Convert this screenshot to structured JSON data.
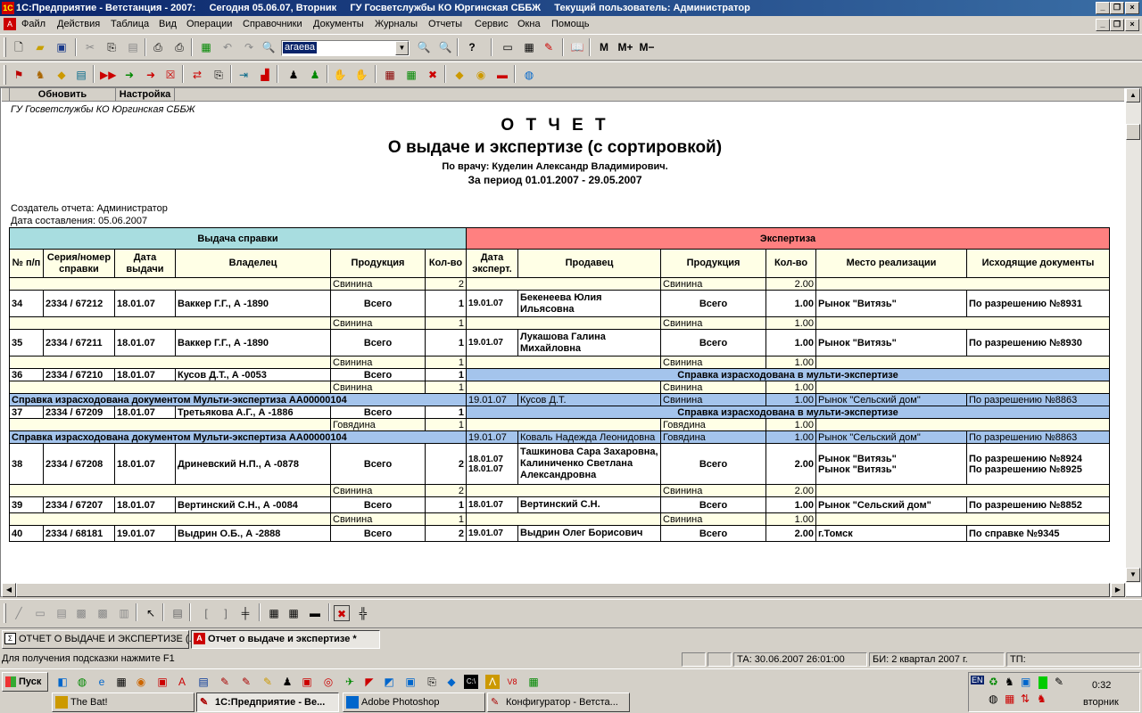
{
  "window": {
    "title": "1С:Предприятие - Ветстанция - 2007:",
    "today": "Сегодня 05.06.07, Вторник",
    "org": "ГУ Госветслужбы КО Юргинская СББЖ",
    "user": "Текущий пользователь: Администратор"
  },
  "menu": [
    "Файл",
    "Действия",
    "Таблица",
    "Вид",
    "Операции",
    "Справочники",
    "Документы",
    "Журналы",
    "Отчеты",
    "Сервис",
    "Окна",
    "Помощь"
  ],
  "toolbar": {
    "search_value": "агаева",
    "m": "M",
    "mplus": "M+",
    "mminus": "M−"
  },
  "docbar": {
    "refresh": "Обновить",
    "settings": "Настройка"
  },
  "report": {
    "org": "ГУ Госветслужбы КО Юргинская СББЖ",
    "title": "О Т Ч Е Т",
    "subtitle": "О выдаче и экспертизе (с сортировкой)",
    "doctor": "По врачу: Куделин Александр Владимирович.",
    "period": "За период 01.01.2007  - 29.05.2007",
    "creator": "Создатель отчета: Администратор",
    "date": "Дата составления: 05.06.2007",
    "head_left": "Выдача справки",
    "head_right": "Экспертиза",
    "cols": [
      "№ п/п",
      "Серия/номер справки",
      "Дата выдачи",
      "Владелец",
      "Продукция",
      "Кол-во",
      "Дата эксперт.",
      "Продавец",
      "Продукция",
      "Кол-во",
      "Место реализации",
      "Исходящие документы"
    ],
    "multi_note": "Справка израсходована в мульти-экспертизе",
    "multi_doc": "Справка израсходована документом Мульти-экспертиза АА00000104",
    "rows": [
      {
        "t": "sub",
        "p": "Свинина",
        "q": "2",
        "ep": "Свинина",
        "eq": "2.00"
      },
      {
        "t": "main",
        "n": "34",
        "s": "2334 / 67212",
        "d": "18.01.07",
        "o": "Ваккер Г.Г., А -1890",
        "p": "Всего",
        "q": "1",
        "ed": "19.01.07",
        "sel": "Бекенеева Юлия Ильясовна",
        "ep": "Всего",
        "eq": "1.00",
        "pl": "Рынок \"Витязь\"",
        "doc": "По разрешению №8931"
      },
      {
        "t": "sub",
        "p": "Свинина",
        "q": "1",
        "ep": "Свинина",
        "eq": "1.00"
      },
      {
        "t": "main",
        "n": "35",
        "s": "2334 / 67211",
        "d": "18.01.07",
        "o": "Ваккер Г.Г., А -1890",
        "p": "Всего",
        "q": "1",
        "ed": "19.01.07",
        "sel": "Лукашова Галина Михайловна",
        "ep": "Всего",
        "eq": "1.00",
        "pl": "Рынок \"Витязь\"",
        "doc": "По разрешению №8930"
      },
      {
        "t": "sub",
        "p": "Свинина",
        "q": "1",
        "ep": "Свинина",
        "eq": "1.00"
      },
      {
        "t": "multi",
        "n": "36",
        "s": "2334 / 67210",
        "d": "18.01.07",
        "o": "Кусов Д.Т., А -0053",
        "p": "Всего",
        "q": "1"
      },
      {
        "t": "sub",
        "p": "Свинина",
        "q": "1",
        "ep": "Свинина",
        "eq": "1.00"
      },
      {
        "t": "mdoc",
        "ed": "19.01.07",
        "sel": "Кусов Д.Т.",
        "ep": "Свинина",
        "eq": "1.00",
        "pl": "Рынок \"Сельский дом\"",
        "doc": "По разрешению №8863"
      },
      {
        "t": "multi",
        "n": "37",
        "s": "2334 / 67209",
        "d": "18.01.07",
        "o": "Третьякова А.Г., А -1886",
        "p": "Всего",
        "q": "1"
      },
      {
        "t": "sub",
        "p": "Говядина",
        "q": "1",
        "ep": "Говядина",
        "eq": "1.00"
      },
      {
        "t": "mdoc",
        "ed": "19.01.07",
        "sel": "Коваль Надежда Леонидовна",
        "ep": "Говядина",
        "eq": "1.00",
        "pl": "Рынок \"Сельский дом\"",
        "doc": "По разрешению №8863"
      },
      {
        "t": "main3",
        "n": "38",
        "s": "2334 / 67208",
        "d": "18.01.07",
        "o": "Дриневский Н.П., А -0878",
        "p": "Всего",
        "q": "2",
        "ed": "18.01.07",
        "ed2": "18.01.07",
        "sel": "Ташкинова Сара Захаровна, Калиниченко Светлана Александровна",
        "ep": "Всего",
        "eq": "2.00",
        "pl": "Рынок \"Витязь\"",
        "pl2": "Рынок \"Витязь\"",
        "doc": "По разрешению №8924",
        "doc2": "По разрешению №8925"
      },
      {
        "t": "sub",
        "p": "Свинина",
        "q": "2",
        "ep": "Свинина",
        "eq": "2.00"
      },
      {
        "t": "main1",
        "n": "39",
        "s": "2334 / 67207",
        "d": "18.01.07",
        "o": "Вертинский С.Н., А -0084",
        "p": "Всего",
        "q": "1",
        "ed": "18.01.07",
        "sel": "Вертинский С.Н.",
        "ep": "Всего",
        "eq": "1.00",
        "pl": "Рынок \"Сельский дом\"",
        "doc": "По разрешению №8852"
      },
      {
        "t": "sub",
        "p": "Свинина",
        "q": "1",
        "ep": "Свинина",
        "eq": "1.00"
      },
      {
        "t": "main1",
        "n": "40",
        "s": "2334 / 68181",
        "d": "19.01.07",
        "o": "Выдрин О.Б., А -2888",
        "p": "Всего",
        "q": "2",
        "ed": "19.01.07",
        "sel": "Выдрин Олег Борисович",
        "ep": "Всего",
        "eq": "2.00",
        "pl": "г.Томск",
        "doc": "По справке №9345"
      }
    ]
  },
  "tabs": [
    "ОТЧЕТ О ВЫДАЧЕ И ЭКСПЕРТИЗЕ (...",
    "Отчет о выдаче и экспертизе  *"
  ],
  "status": {
    "hint": "Для получения подсказки нажмите F1",
    "ta": "ТА: 30.06.2007  26:01:00",
    "bi": "БИ: 2 квартал 2007 г.",
    "tp": "ТП:"
  },
  "taskbar": {
    "start": "Пуск",
    "tasks": [
      "The Bat!",
      "1С:Предприятие - Ве...",
      "Adobe Photoshop",
      "Конфигуратор - Ветста..."
    ],
    "lang": "EN",
    "time": "0:32",
    "day": "вторник"
  }
}
